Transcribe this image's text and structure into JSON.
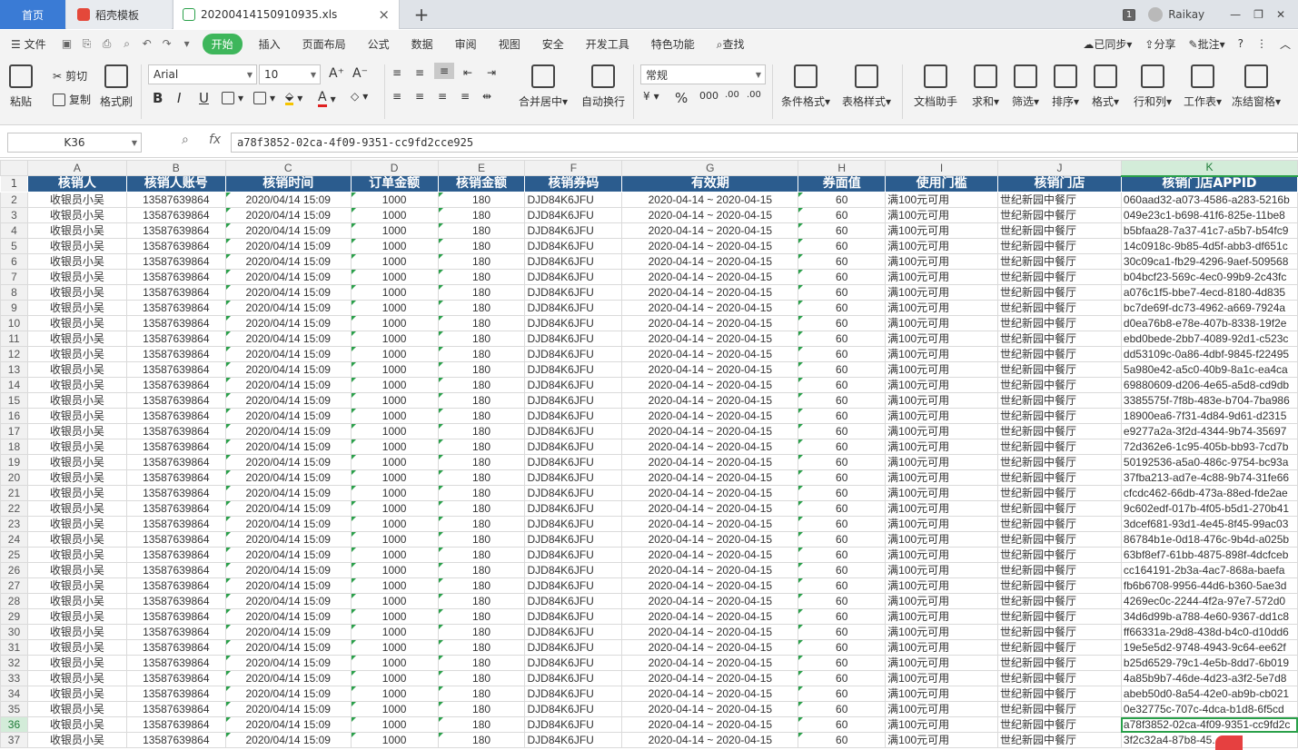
{
  "tabs": {
    "home": "首页",
    "template": "稻壳模板",
    "file": "20200414150910935.xls",
    "close": "×",
    "add": "+"
  },
  "window": {
    "badge": "1",
    "user": "Raikay",
    "min": "—",
    "restore": "❐",
    "close": "✕"
  },
  "menu": {
    "file": "文件",
    "items": [
      "开始",
      "插入",
      "页面布局",
      "公式",
      "数据",
      "审阅",
      "视图",
      "安全",
      "开发工具",
      "特色功能"
    ],
    "search": "查找",
    "sync": "已同步",
    "share": "分享",
    "comment": "批注",
    "help": "?"
  },
  "ribbon": {
    "paste": "粘贴",
    "cut": "剪切",
    "copy": "复制",
    "format_painter": "格式刷",
    "font_name": "Arial",
    "font_size": "10",
    "merge": "合并居中",
    "wrap": "自动换行",
    "number_format": "常规",
    "cond_format": "条件格式",
    "table_style": "表格样式",
    "doc_helper": "文档助手",
    "sum": "求和",
    "filter": "筛选",
    "sort": "排序",
    "format": "格式",
    "row_col": "行和列",
    "sheet": "工作表",
    "freeze": "冻结窗格"
  },
  "formula_bar": {
    "name_box": "K36",
    "fx": "fx",
    "value": "a78f3852-02ca-4f09-9351-cc9fd2cce925"
  },
  "columns": [
    "A",
    "B",
    "C",
    "D",
    "E",
    "F",
    "G",
    "H",
    "I",
    "J",
    "K"
  ],
  "headers": [
    "核销人",
    "核销人账号",
    "核销时间",
    "订单金额",
    "核销金额",
    "核销券码",
    "有效期",
    "券面值",
    "使用门槛",
    "核销门店",
    "核销门店APPID"
  ],
  "row_template": {
    "cashier": "收银员小吴",
    "account": "13587639864",
    "time": "2020/04/14 15:09",
    "order_amount": "1000",
    "write_off_amount": "180",
    "code": "DJD84K6JFU",
    "validity": "2020-04-14 ~ 2020-04-15",
    "face_value": "60",
    "threshold": "满100元可用",
    "store": "世纪新园中餐厅"
  },
  "appids": [
    "060aad32-a073-4586-a283-5216b",
    "049e23c1-b698-41f6-825e-11be8",
    "b5bfaa28-7a37-41c7-a5b7-b54fc9",
    "14c0918c-9b85-4d5f-abb3-df651c",
    "30c09ca1-fb29-4296-9aef-509568",
    "b04bcf23-569c-4ec0-99b9-2c43fc",
    "a076c1f5-bbe7-4ecd-8180-4d835",
    "bc7de69f-dc73-4962-a669-7924a",
    "d0ea76b8-e78e-407b-8338-19f2e",
    "ebd0bede-2bb7-4089-92d1-c523c",
    "dd53109c-0a86-4dbf-9845-f22495",
    "5a980e42-a5c0-40b9-8a1c-ea4ca",
    "69880609-d206-4e65-a5d8-cd9db",
    "3385575f-7f8b-483e-b704-7ba986",
    "18900ea6-7f31-4d84-9d61-d2315",
    "e9277a2a-3f2d-4344-9b74-35697",
    "72d362e6-1c95-405b-bb93-7cd7b",
    "50192536-a5a0-486c-9754-bc93a",
    "37fba213-ad7e-4c88-9b74-31fe66",
    "cfcdc462-66db-473a-88ed-fde2ae",
    "9c602edf-017b-4f05-b5d1-270b41",
    "3dcef681-93d1-4e45-8f45-99ac03",
    "86784b1e-0d18-476c-9b4d-a025b",
    "63bf8ef7-61bb-4875-898f-4dcfceb",
    "cc164191-2b3a-4ac7-868a-baefa",
    "fb6b6708-9956-44d6-b360-5ae3d",
    "4269ec0c-2244-4f2a-97e7-572d0",
    "34d6d99b-a788-4e60-9367-dd1c8",
    "ff66331a-29d8-438d-b4c0-d10dd6",
    "19e5e5d2-9748-4943-9c64-ee62f",
    "b25d6529-79c1-4e5b-8dd7-6b019",
    "4a85b9b7-46de-4d23-a3f2-5e7d8",
    "abeb50d0-8a54-42e0-ab9b-cb021",
    "0e32775c-707c-4dca-b1d8-6f5cd",
    "a78f3852-02ca-4f09-9351-cc9fd2c",
    "3f2c32a4-87b8-45..."
  ],
  "active_cell": "K36",
  "accent_green": "#2aa04a",
  "header_blue": "#2b5c8e"
}
